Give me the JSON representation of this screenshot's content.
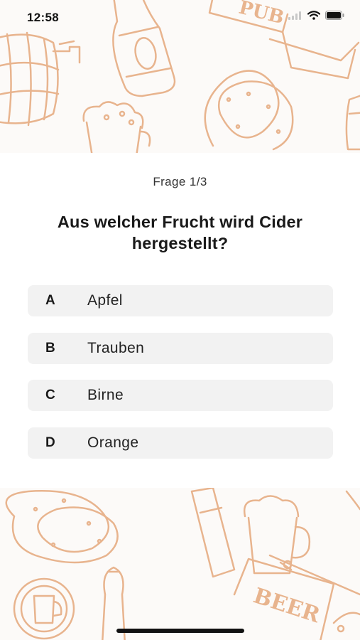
{
  "status_bar": {
    "time": "12:58",
    "icons": [
      "signal-icon",
      "wifi-icon",
      "battery-icon"
    ]
  },
  "background": {
    "pattern_color": "#e8b48e",
    "pattern_labels": {
      "sign_top": "PUB",
      "sign_bottom": "BEER"
    }
  },
  "quiz": {
    "progress": "Frage 1/3",
    "question": "Aus welcher Frucht wird Cider hergestellt?",
    "answers": [
      {
        "letter": "A",
        "text": "Apfel"
      },
      {
        "letter": "B",
        "text": "Trauben"
      },
      {
        "letter": "C",
        "text": "Birne"
      },
      {
        "letter": "D",
        "text": "Orange"
      }
    ]
  }
}
